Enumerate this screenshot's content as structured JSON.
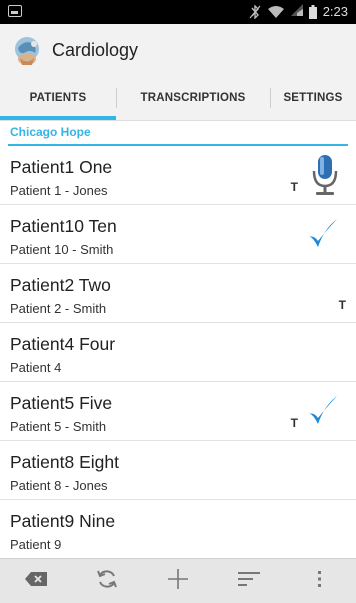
{
  "status_bar": {
    "time": "2:23"
  },
  "app": {
    "title": "Cardiology"
  },
  "tabs": [
    {
      "label": "PATIENTS",
      "active": true
    },
    {
      "label": "TRANSCRIPTIONS",
      "active": false
    },
    {
      "label": "SETTINGS",
      "active": false
    }
  ],
  "section": {
    "label": "Chicago Hope"
  },
  "patients": [
    {
      "name": "Patient1 One",
      "detail": "Patient 1 - Jones",
      "has_t": true,
      "status_icon": "microphone-icon"
    },
    {
      "name": "Patient10 Ten",
      "detail": "Patient 10 - Smith",
      "has_t": false,
      "status_icon": "checkmark-icon"
    },
    {
      "name": "Patient2 Two",
      "detail": "Patient 2 - Smith",
      "has_t": true,
      "status_icon": ""
    },
    {
      "name": "Patient4 Four",
      "detail": "Patient 4",
      "has_t": false,
      "status_icon": ""
    },
    {
      "name": "Patient5 Five",
      "detail": "Patient 5 - Smith",
      "has_t": true,
      "status_icon": "checkmark-icon"
    },
    {
      "name": "Patient8 Eight",
      "detail": "Patient 8 - Jones",
      "has_t": false,
      "status_icon": ""
    },
    {
      "name": "Patient9 Nine",
      "detail": "Patient 9",
      "has_t": false,
      "status_icon": ""
    }
  ],
  "t_glyph": "T",
  "bottom_bar": [
    "clear-icon",
    "sync-icon",
    "add-icon",
    "sort-icon",
    "overflow-menu-icon"
  ],
  "colors": {
    "accent": "#33b5e5",
    "check": "#1e88d8"
  }
}
